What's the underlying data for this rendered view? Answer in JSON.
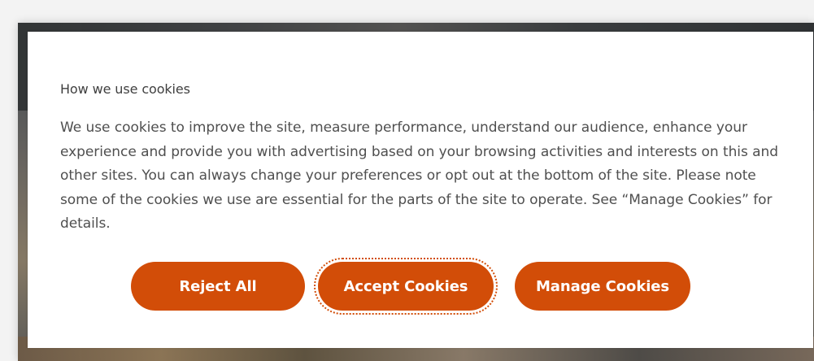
{
  "cookie_banner": {
    "title": "How we use cookies",
    "body": "We use cookies to improve the site, measure performance, understand our audience, enhance your experience and provide you with advertising based on your browsing activities and interests on this and other sites. You can always change your preferences or opt out at the bottom of the site. Please note some of the cookies we use are essential for the parts of the site to operate. See “Manage Cookies” for details.",
    "buttons": {
      "reject": "Reject All",
      "accept": "Accept Cookies",
      "manage": "Manage Cookies"
    }
  },
  "colors": {
    "button_background": "#d24d08",
    "modal_background": "#ffffff",
    "text": "#4f4f4f"
  }
}
